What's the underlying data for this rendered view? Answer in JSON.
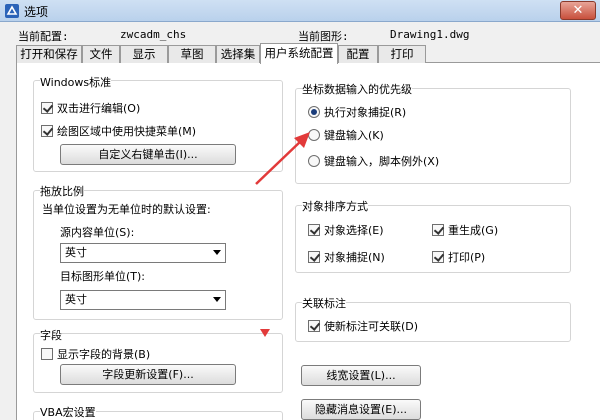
{
  "window": {
    "title": "选项",
    "close_glyph": "✕"
  },
  "config": {
    "current_config_label": "当前配置:",
    "current_config_value": "zwcadm_chs",
    "current_drawing_label": "当前图形:",
    "current_drawing_value": "Drawing1.dwg"
  },
  "tabs": [
    {
      "label": "打开和保存"
    },
    {
      "label": "文件"
    },
    {
      "label": "显示"
    },
    {
      "label": "草图"
    },
    {
      "label": "选择集"
    },
    {
      "label": "用户系统配置",
      "active": true
    },
    {
      "label": "配置"
    },
    {
      "label": "打印"
    }
  ],
  "windows_std": {
    "title": "Windows标准",
    "double_click_edit": {
      "label": "双击进行编辑(O)",
      "checked": true
    },
    "shortcut_menu": {
      "label": "绘图区域中使用快捷菜单(M)",
      "checked": true
    },
    "custom_right_click_button": "自定义右键单击(I)..."
  },
  "drag_scale": {
    "title": "拖放比例",
    "desc": "当单位设置为无单位时的默认设置:",
    "source_label": "源内容单位(S):",
    "source_value": "英寸",
    "target_label": "目标图形单位(T):",
    "target_value": "英寸"
  },
  "fields": {
    "title": "字段",
    "show_background": {
      "label": "显示字段的背景(B)",
      "checked": false
    },
    "update_settings_button": "字段更新设置(F)..."
  },
  "vba": {
    "title": "VBA宏设置"
  },
  "coord_priority": {
    "title": "坐标数据输入的优先级",
    "options": [
      {
        "label": "执行对象捕捉(R)",
        "selected": true
      },
      {
        "label": "键盘输入(K)",
        "selected": false
      },
      {
        "label": "键盘输入，脚本例外(X)",
        "selected": false
      }
    ]
  },
  "sort_methods": {
    "title": "对象排序方式",
    "object_select": {
      "label": "对象选择(E)",
      "checked": true
    },
    "regen": {
      "label": "重生成(G)",
      "checked": true
    },
    "object_snap": {
      "label": "对象捕捉(N)",
      "checked": true
    },
    "plot": {
      "label": "打印(P)",
      "checked": true
    }
  },
  "assoc_dim": {
    "title": "关联标注",
    "make_assoc": {
      "label": "使新标注可关联(D)",
      "checked": true
    }
  },
  "buttons": {
    "lineweight": "线宽设置(L)...",
    "hidden_msg": "隐藏消息设置(E)..."
  },
  "colors": {
    "annotation_arrow": "#e23a3a"
  }
}
